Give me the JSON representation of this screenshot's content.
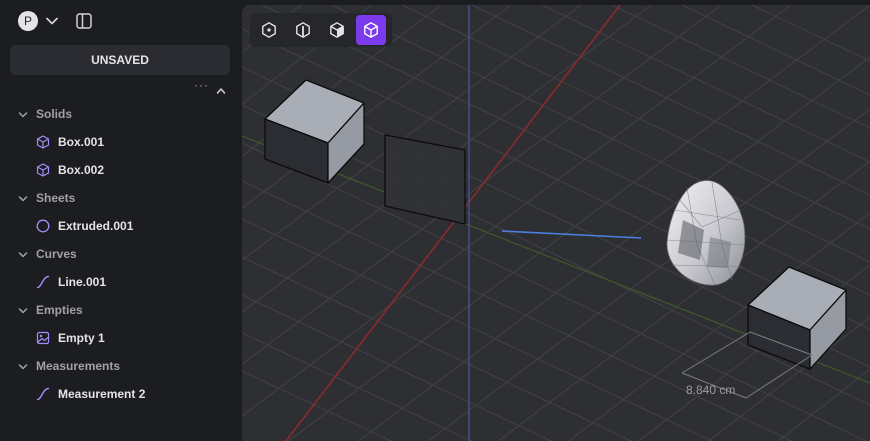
{
  "header": {
    "avatar_letter": "P",
    "avatar_icon": "user-avatar",
    "dropdown_icon": "chevron-down-icon",
    "panel_icon": "sidebar-toggle-icon"
  },
  "document": {
    "save_status": "UNSAVED"
  },
  "tree_tools": {
    "more_icon": "more-dots-icon",
    "collapse_icon": "chevron-up-icon"
  },
  "tree": {
    "groups": [
      {
        "label": "Solids",
        "items": [
          {
            "label": "Box.001",
            "icon": "cube-icon"
          },
          {
            "label": "Box.002",
            "icon": "cube-icon"
          }
        ]
      },
      {
        "label": "Sheets",
        "items": [
          {
            "label": "Extruded.001",
            "icon": "circle-icon"
          }
        ]
      },
      {
        "label": "Curves",
        "items": [
          {
            "label": "Line.001",
            "icon": "curve-icon"
          }
        ]
      },
      {
        "label": "Empties",
        "items": [
          {
            "label": "Empty 1",
            "icon": "image-icon"
          }
        ]
      },
      {
        "label": "Measurements",
        "items": [
          {
            "label": "Measurement 2",
            "icon": "curve-icon"
          }
        ]
      }
    ]
  },
  "viewport_tools": {
    "modes": [
      {
        "icon": "vertex-mode-icon",
        "active": false
      },
      {
        "icon": "edge-mode-icon",
        "active": false
      },
      {
        "icon": "face-mode-icon",
        "active": false
      },
      {
        "icon": "solid-mode-icon",
        "active": true
      }
    ]
  },
  "measurement": {
    "value": "8.840 cm"
  },
  "colors": {
    "accent": "#7c3aed",
    "accent_icon": "#a78bfa",
    "x_axis": "#8c2a2a",
    "y_axis": "#3e5a2c",
    "z_axis": "#4a4f90",
    "selection_line": "#4a7fe0"
  }
}
